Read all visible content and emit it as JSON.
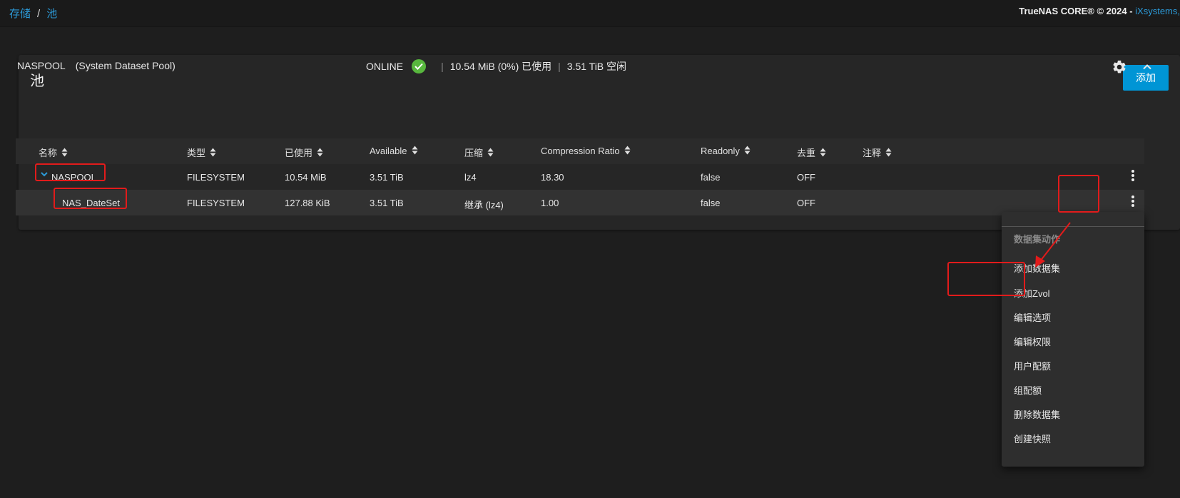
{
  "breadcrumb": {
    "items": [
      "存储",
      "池"
    ],
    "separator": "/"
  },
  "footer_brand": {
    "text": "TrueNAS CORE® © 2024 - ",
    "link": "iXsystems,"
  },
  "card": {
    "title": "池",
    "add_label": "添加"
  },
  "pool": {
    "name": "NASPOOL",
    "subtitle": "(System Dataset Pool)",
    "status": "ONLINE",
    "used": "10.54 MiB (0%) 已使用",
    "free": "3.51 TiB 空闲",
    "separator": "|"
  },
  "table": {
    "columns": [
      "名称",
      "类型",
      "已使用",
      "Available",
      "压缩",
      "Compression Ratio",
      "Readonly",
      "去重",
      "注释"
    ],
    "rows": [
      {
        "name": "NASPOOL",
        "type": "FILESYSTEM",
        "used": "10.54 MiB",
        "available": "3.51 TiB",
        "compression": "lz4",
        "ratio": "18.30",
        "readonly": "false",
        "dedup": "OFF",
        "comment": ""
      },
      {
        "name": "NAS_DateSet",
        "type": "FILESYSTEM",
        "used": "127.88 KiB",
        "available": "3.51 TiB",
        "compression": "继承 (lz4)",
        "ratio": "1.00",
        "readonly": "false",
        "dedup": "OFF",
        "comment": ""
      }
    ]
  },
  "dataset_menu": {
    "title": "数据集动作",
    "items": [
      "添加数据集",
      "添加Zvol",
      "编辑选项",
      "编辑权限",
      "用户配额",
      "组配额",
      "删除数据集",
      "创建快照"
    ]
  },
  "colors": {
    "accent": "#0095d5",
    "link": "#2c9ad8",
    "status_ok": "#58b73e",
    "annotation": "#e21b1b",
    "background": "#1e1e1e",
    "card": "#262626"
  },
  "icons": [
    "check-circle-icon",
    "gear-icon",
    "chevron-up-icon",
    "chevron-down-icon",
    "sort-icon",
    "more-vert-icon"
  ]
}
